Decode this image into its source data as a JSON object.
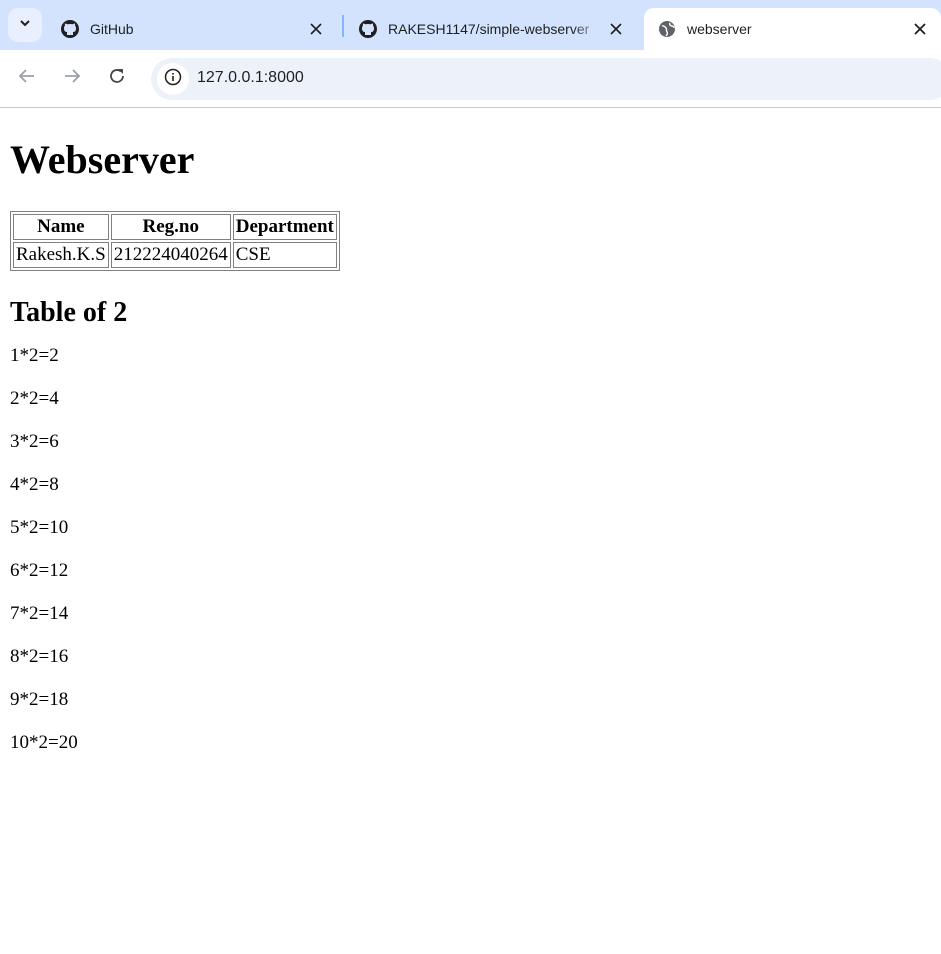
{
  "browser": {
    "tabs": [
      {
        "title": "GitHub",
        "icon": "github-icon"
      },
      {
        "title": "RAKESH1147/simple-webserver",
        "icon": "github-icon"
      },
      {
        "title": "webserver",
        "icon": "globe-icon",
        "active": true
      }
    ],
    "url": "127.0.0.1:8000"
  },
  "page": {
    "heading": "Webserver",
    "table": {
      "headers": [
        "Name",
        "Reg.no",
        "Department"
      ],
      "rows": [
        [
          "Rakesh.K.S",
          "212224040264",
          "CSE"
        ]
      ]
    },
    "subheading": "Table of 2",
    "lines": [
      "1*2=2",
      "2*2=4",
      "3*2=6",
      "4*2=8",
      "5*2=10",
      "6*2=12",
      "7*2=14",
      "8*2=16",
      "9*2=18",
      "10*2=20"
    ]
  }
}
